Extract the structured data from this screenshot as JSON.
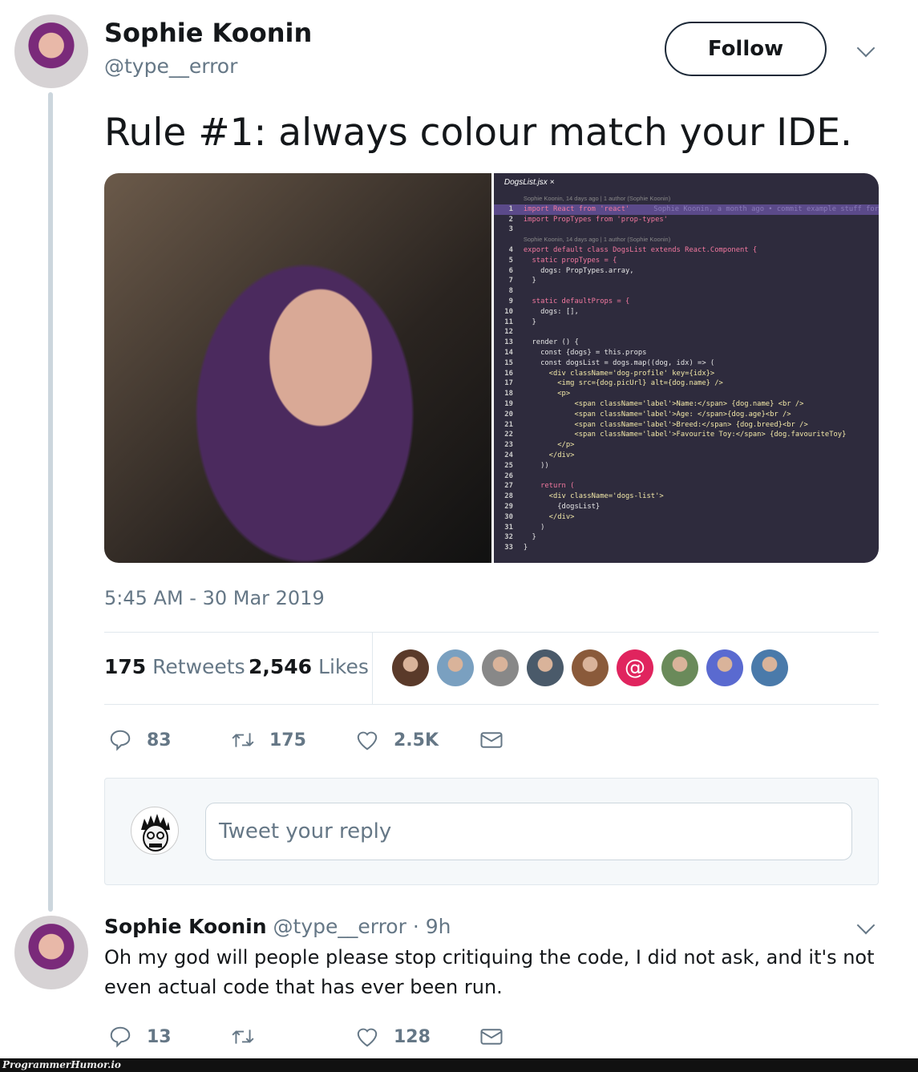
{
  "tweet": {
    "author_name": "Sophie Koonin",
    "handle": "@type__error",
    "follow_label": "Follow",
    "text": "Rule #1: always colour match your IDE.",
    "timestamp": "5:45 AM - 30 Mar 2019",
    "retweets_count": "175",
    "retweets_label": "Retweets",
    "likes_count": "2,546",
    "likes_label": "Likes",
    "liker_colors": [
      "#5a3a2a",
      "#7aa0c0",
      "#888888",
      "#4a5a6a",
      "#8a5a3a",
      "#e0245e",
      "#6a8a5a",
      "#5a6ad0",
      "#4a7aaa"
    ],
    "liker_at_symbol": "@",
    "actions": {
      "replies": "83",
      "retweets": "175",
      "likes": "2.5K"
    }
  },
  "code_panel": {
    "tab": "DogsList.jsx",
    "tab_close": "×",
    "blame_header_1": "Sophie Koonin, 14 days ago | 1 author (Sophie Koonin)",
    "blame_header_2": "Sophie Koonin, 14 days ago | 1 author (Sophie Koonin)",
    "inline_blame": "Sophie Koonin, a month ago • commit example stuff for",
    "lines": [
      "import React from 'react'",
      "import PropTypes from 'prop-types'",
      "",
      "export default class DogsList extends React.Component {",
      "  static propTypes = {",
      "    dogs: PropTypes.array,",
      "  }",
      "",
      "  static defaultProps = {",
      "    dogs: [],",
      "  }",
      "",
      "  render () {",
      "    const {dogs} = this.props",
      "    const dogsList = dogs.map((dog, idx) => (",
      "      <div className='dog-profile' key={idx}>",
      "        <img src={dog.picUrl} alt={dog.name} />",
      "        <p>",
      "            <span className='label'>Name:</span> {dog.name} <br />",
      "            <span className='label'>Age: </span>{dog.age}<br />",
      "            <span className='label'>Breed:</span> {dog.breed}<br />",
      "            <span className='label'>Favourite Toy:</span> {dog.favouriteToy}",
      "        </p>",
      "      </div>",
      "    ))",
      "",
      "    return (",
      "      <div className='dogs-list'>",
      "        {dogsList}",
      "      </div>",
      "    )",
      "  }",
      "}"
    ]
  },
  "reply": {
    "placeholder": "Tweet your reply"
  },
  "reply_tweet": {
    "author_name": "Sophie Koonin",
    "handle": "@type__error",
    "time": "· 9h",
    "text_line1": "Oh my god will people please stop critiquing the code, I did not ask, and it's not",
    "text_line2": "even actual code that has ever been run.",
    "actions": {
      "replies": "13",
      "likes": "128"
    }
  },
  "watermark": "ProgrammerHumor.io"
}
